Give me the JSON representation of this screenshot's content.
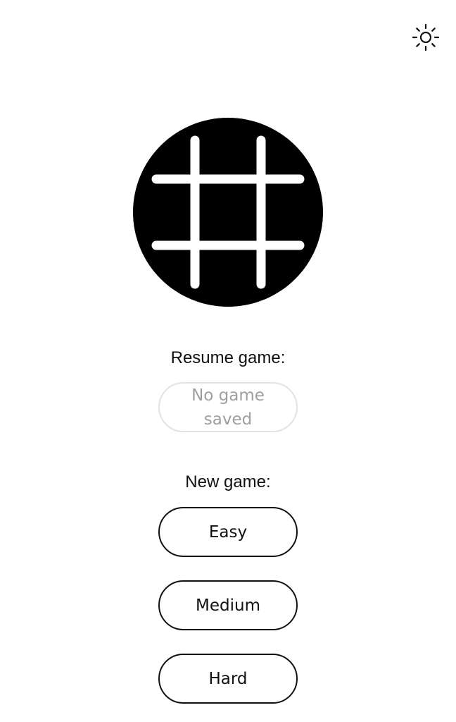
{
  "header": {
    "theme_icon": "sun-icon"
  },
  "logo": {
    "icon": "tic-tac-toe-grid-icon",
    "circle_color": "#000000",
    "grid_color": "#ffffff"
  },
  "resume": {
    "label": "Resume game:",
    "button_label": "No game saved",
    "enabled": false
  },
  "new_game": {
    "label": "New game:",
    "easy_label": "Easy",
    "medium_label": "Medium",
    "hard_label": "Hard"
  },
  "colors": {
    "text": "#111111",
    "disabled_text": "#9e9e9e",
    "disabled_border": "#e2e2e2",
    "background": "#ffffff"
  }
}
